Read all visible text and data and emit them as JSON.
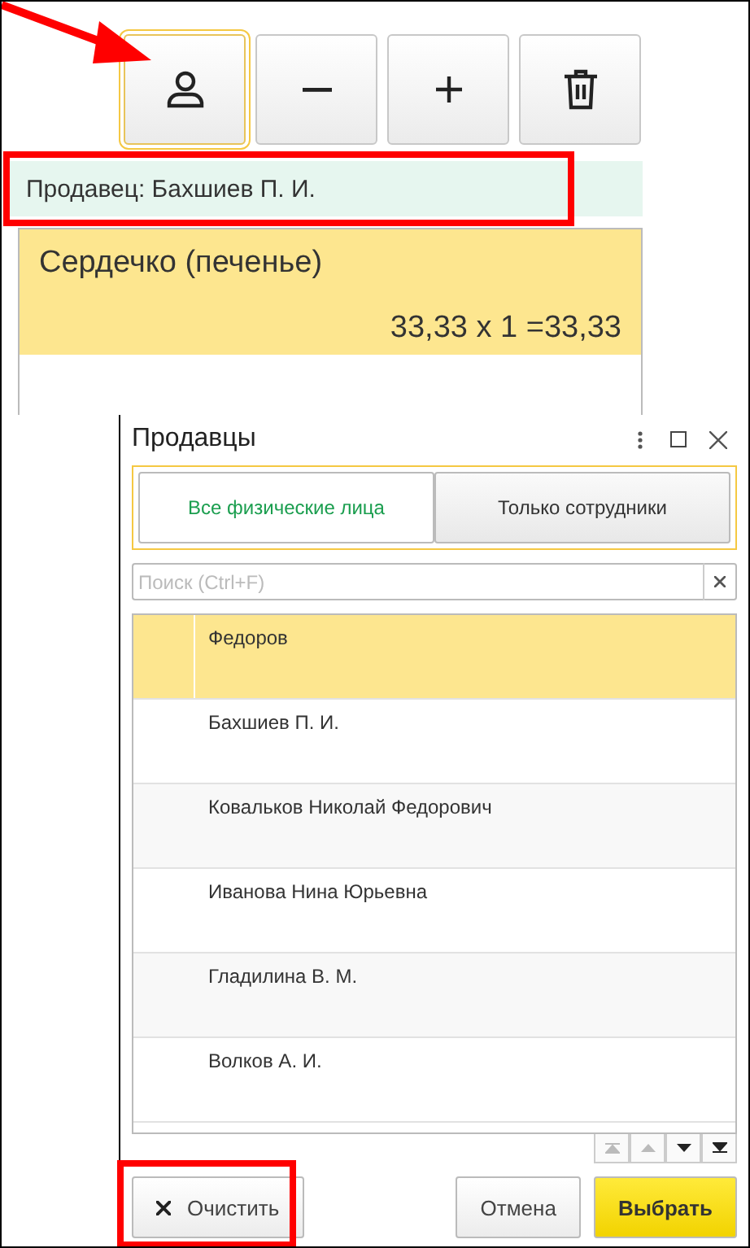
{
  "toolbar": [
    {
      "kind": "person",
      "selected": true
    },
    {
      "kind": "minus",
      "selected": false
    },
    {
      "kind": "plus",
      "selected": false
    },
    {
      "kind": "trash",
      "selected": false
    }
  ],
  "seller": "Продавец: Бахшиев П. И.",
  "product": {
    "name": "Сердечко (печенье)",
    "price_line": "33,33 x 1 =33,33",
    "selected": true
  },
  "dialog": {
    "title": "Продавцы",
    "tabs": [
      {
        "label": "Все физические лица",
        "selected": true
      },
      {
        "label": "Только сотрудники",
        "selected": false
      }
    ],
    "search": {
      "placeholder": "Поиск (Ctrl+F)"
    },
    "rows": [
      {
        "name": "Федоров",
        "selected": true
      },
      {
        "name": "Бахшиев П. И.",
        "selected": false
      },
      {
        "name": "Ковальков  Николай Федорович",
        "selected": false
      },
      {
        "name": "Иванова Нина Юрьевна",
        "selected": false
      },
      {
        "name": "Гладилина В. М.",
        "selected": false
      },
      {
        "name": "Волков А. И.",
        "selected": false
      }
    ],
    "buttons": [
      {
        "kind": "clear",
        "label": "Очистить"
      },
      {
        "kind": "cancel",
        "label": "Отмена"
      },
      {
        "kind": "choose",
        "label": "Выбрать"
      }
    ]
  }
}
